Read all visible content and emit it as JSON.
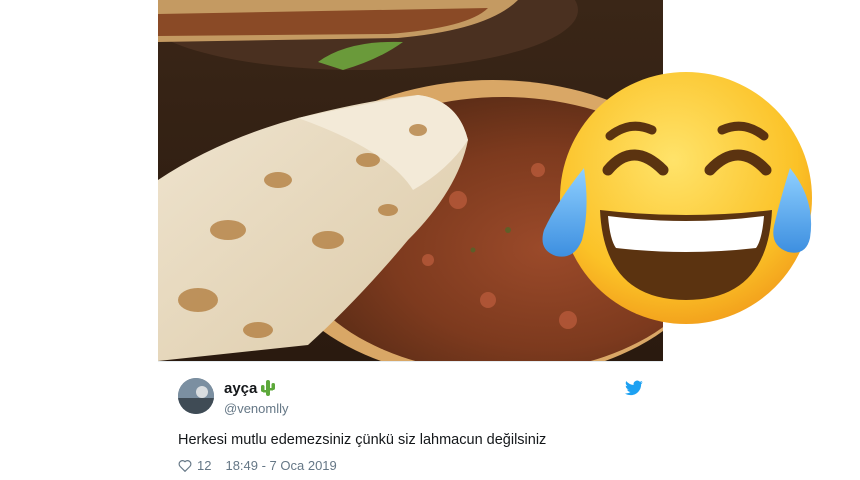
{
  "tweet": {
    "display_name": "ayça",
    "name_emoji": "cactus-icon",
    "handle": "@venomlly",
    "text": "Herkesi mutlu edemezsiniz çünkü siz lahmacun değilsiniz",
    "likes": "12",
    "timestamp": "18:49 - 7 Oca 2019",
    "like_icon": "heart-icon",
    "platform_icon": "twitter-bird-icon"
  },
  "overlay": {
    "emoji": "face-with-tears-of-joy-icon"
  },
  "photo": {
    "subject": "lahmacun-photo"
  },
  "colors": {
    "brand": "#1da1f2",
    "text": "#14171a",
    "secondary": "#657786",
    "emoji_yellow": "#fbc227",
    "tears": "#5eb3f2"
  }
}
